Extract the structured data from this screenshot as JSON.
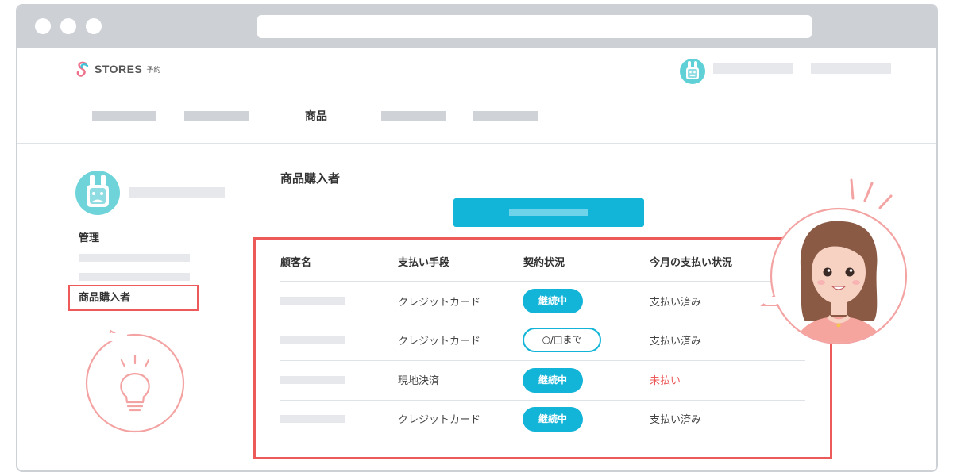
{
  "brand": {
    "name": "STORES",
    "sub": "予約"
  },
  "nav": {
    "active_tab": "商品"
  },
  "sidebar": {
    "section_label": "管理",
    "active_item": "商品購入者"
  },
  "main": {
    "title": "商品購入者",
    "table": {
      "headers": [
        "顧客名",
        "支払い手段",
        "契約状況",
        "今月の支払い状況"
      ],
      "rows": [
        {
          "payment_method": "クレジットカード",
          "contract": "継続中",
          "status": "支払い済み"
        },
        {
          "payment_method": "クレジットカード",
          "contract": "○/□まで",
          "status": "支払い済み"
        },
        {
          "payment_method": "現地決済",
          "contract": "継続中",
          "status": "未払い"
        },
        {
          "payment_method": "クレジットカード",
          "contract": "継続中",
          "status": "支払い済み"
        }
      ]
    }
  },
  "colors": {
    "accent": "#12b5d8",
    "highlight": "#ec5a5a",
    "placeholder": "#e6e8eb",
    "mascot": "#5fd0d6"
  },
  "icons": [
    "stores-logo-icon",
    "rabbit-avatar-icon",
    "lightbulb-icon",
    "woman-avatar-icon"
  ]
}
